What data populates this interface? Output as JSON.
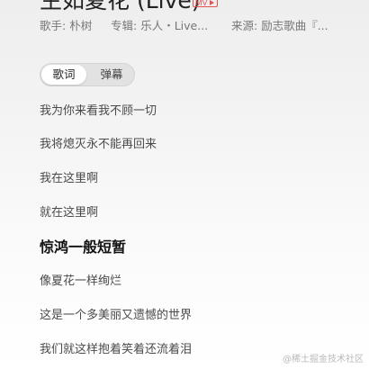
{
  "song": {
    "title": "生如夏花 (Live)",
    "mv_badge": "MV"
  },
  "meta": {
    "singer_label": "歌手:",
    "singer": "朴树",
    "album_label": "专辑:",
    "album": "乐人・Live...",
    "source_label": "来源:",
    "source": "励志歌曲『..."
  },
  "tabs": {
    "lyrics": "歌词",
    "danmaku": "弹幕",
    "active": "lyrics"
  },
  "lyrics": [
    "我为你来看我不顾一切",
    "我将熄灭永不能再回来",
    "我在这里啊",
    "就在这里啊",
    "惊鸿一般短暂",
    "像夏花一样绚烂",
    "这是一个多美丽又遗憾的世界",
    "我们就这样抱着笑着还流着泪"
  ],
  "active_lyric_index": 4,
  "watermark": "@稀土掘金技术社区"
}
